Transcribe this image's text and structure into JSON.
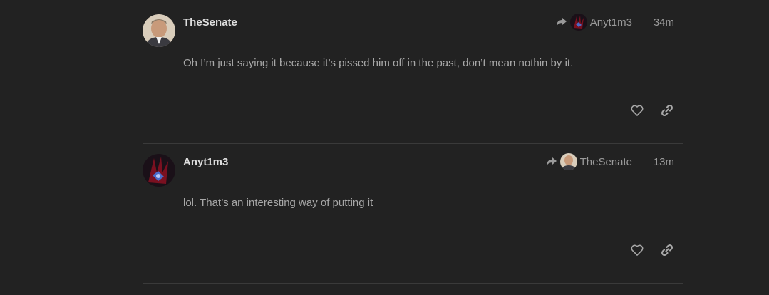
{
  "posts": [
    {
      "username": "TheSenate",
      "reply_to": "Anyt1m3",
      "time": "34m",
      "body": "Oh I’m just saying it because it’s pissed him off in the past, don’t mean nothin by it.",
      "avatar": "thesenate-avatar",
      "reply_avatar": "anyt1m3-avatar"
    },
    {
      "username": "Anyt1m3",
      "reply_to": "TheSenate",
      "time": "13m",
      "body": "lol. That’s an interesting way of putting it",
      "avatar": "anyt1m3-avatar",
      "reply_avatar": "thesenate-avatar"
    }
  ],
  "icons": {
    "reply": "share-arrow-icon",
    "like": "heart-icon",
    "link": "link-icon"
  },
  "colors": {
    "background": "#222222",
    "username": "#dddddd",
    "muted": "#9a9a9a",
    "body": "#a8a8a8",
    "divider": "#3a3a3a"
  }
}
